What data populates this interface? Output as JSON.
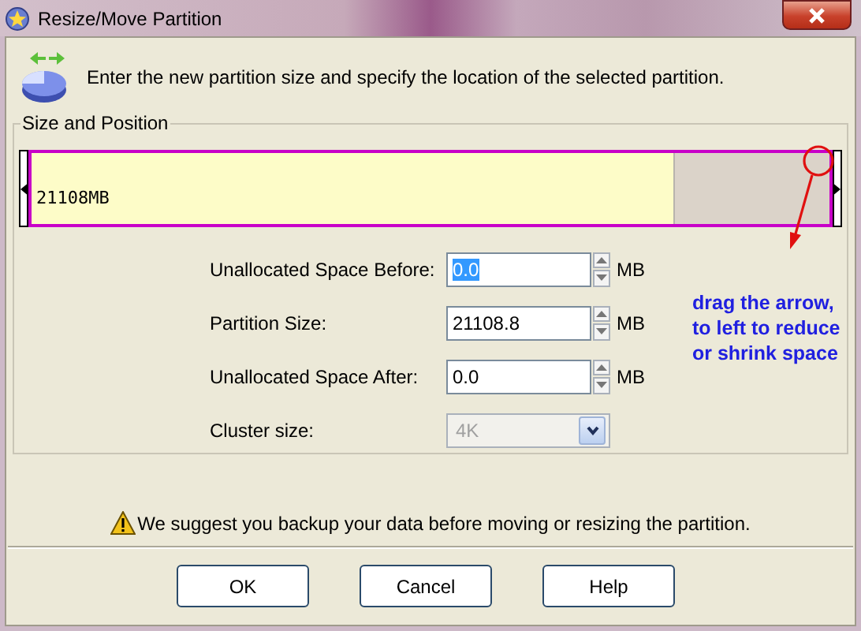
{
  "window": {
    "title": "Resize/Move Partition"
  },
  "instruction": "Enter the new partition size and specify the location of the selected partition.",
  "group": {
    "title": "Size and Position",
    "partition_bar": {
      "label": "21108MB",
      "level": 0.805
    },
    "fields": [
      {
        "kind": "spin",
        "label": "Unallocated Space Before:",
        "value": "0.0",
        "unit": "MB",
        "highlighted": true,
        "disabled": false
      },
      {
        "kind": "spin",
        "label": "Partition Size:",
        "value": "21108.8",
        "unit": "MB",
        "highlighted": false,
        "disabled": false
      },
      {
        "kind": "spin",
        "label": "Unallocated Space After:",
        "value": "0.0",
        "unit": "MB",
        "highlighted": false,
        "disabled": false
      },
      {
        "kind": "combo",
        "label": "Cluster size:",
        "value": "4K",
        "disabled": true
      }
    ]
  },
  "annotation": "drag the arrow, to left to reduce or shrink space",
  "warning": "We suggest you backup your data before moving or resizing the partition.",
  "buttons": [
    "OK",
    "Cancel",
    "Help"
  ]
}
